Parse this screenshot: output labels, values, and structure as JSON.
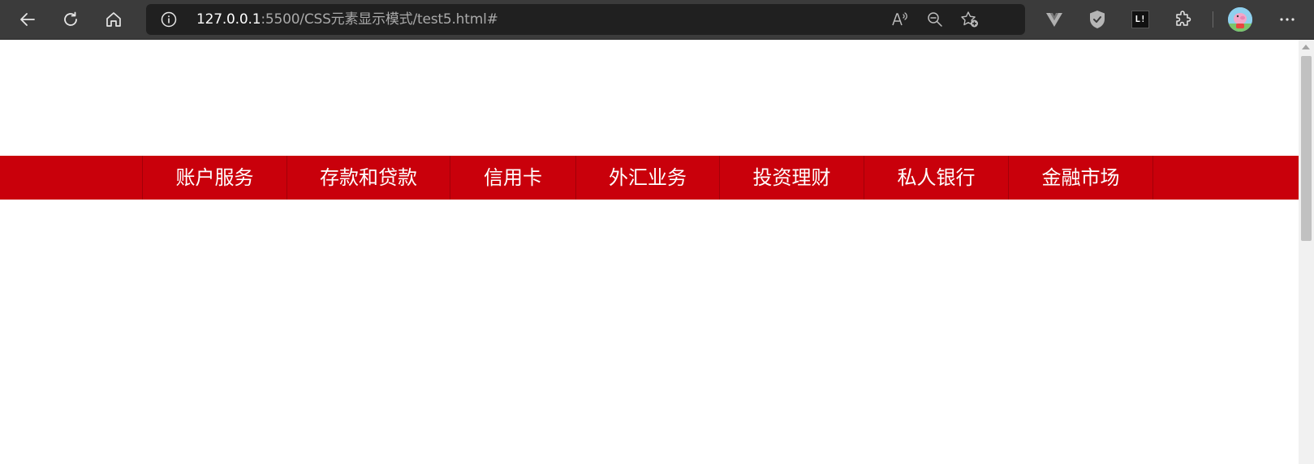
{
  "browser": {
    "url_host": "127.0.0.1",
    "url_rest": ":5500/CSS元素显示模式/test5.html#",
    "icons": {
      "back": "back-arrow-icon",
      "reload": "reload-icon",
      "home": "home-icon",
      "info": "info-icon",
      "read_aloud": "read-aloud-icon",
      "zoom": "zoom-out-icon",
      "favorite": "add-favorite-icon",
      "extension1": "vue-devtools-icon",
      "extension2": "shield-icon",
      "extension3": "extension-badge-icon",
      "extensions": "puzzle-icon",
      "profile": "profile-avatar",
      "menu": "more-menu-icon"
    },
    "extension3_text": "L!"
  },
  "nav": {
    "background": "#c9000b",
    "items": [
      {
        "label": "账户服务"
      },
      {
        "label": "存款和贷款"
      },
      {
        "label": "信用卡"
      },
      {
        "label": "外汇业务"
      },
      {
        "label": "投资理财"
      },
      {
        "label": "私人银行"
      },
      {
        "label": "金融市场"
      }
    ]
  }
}
